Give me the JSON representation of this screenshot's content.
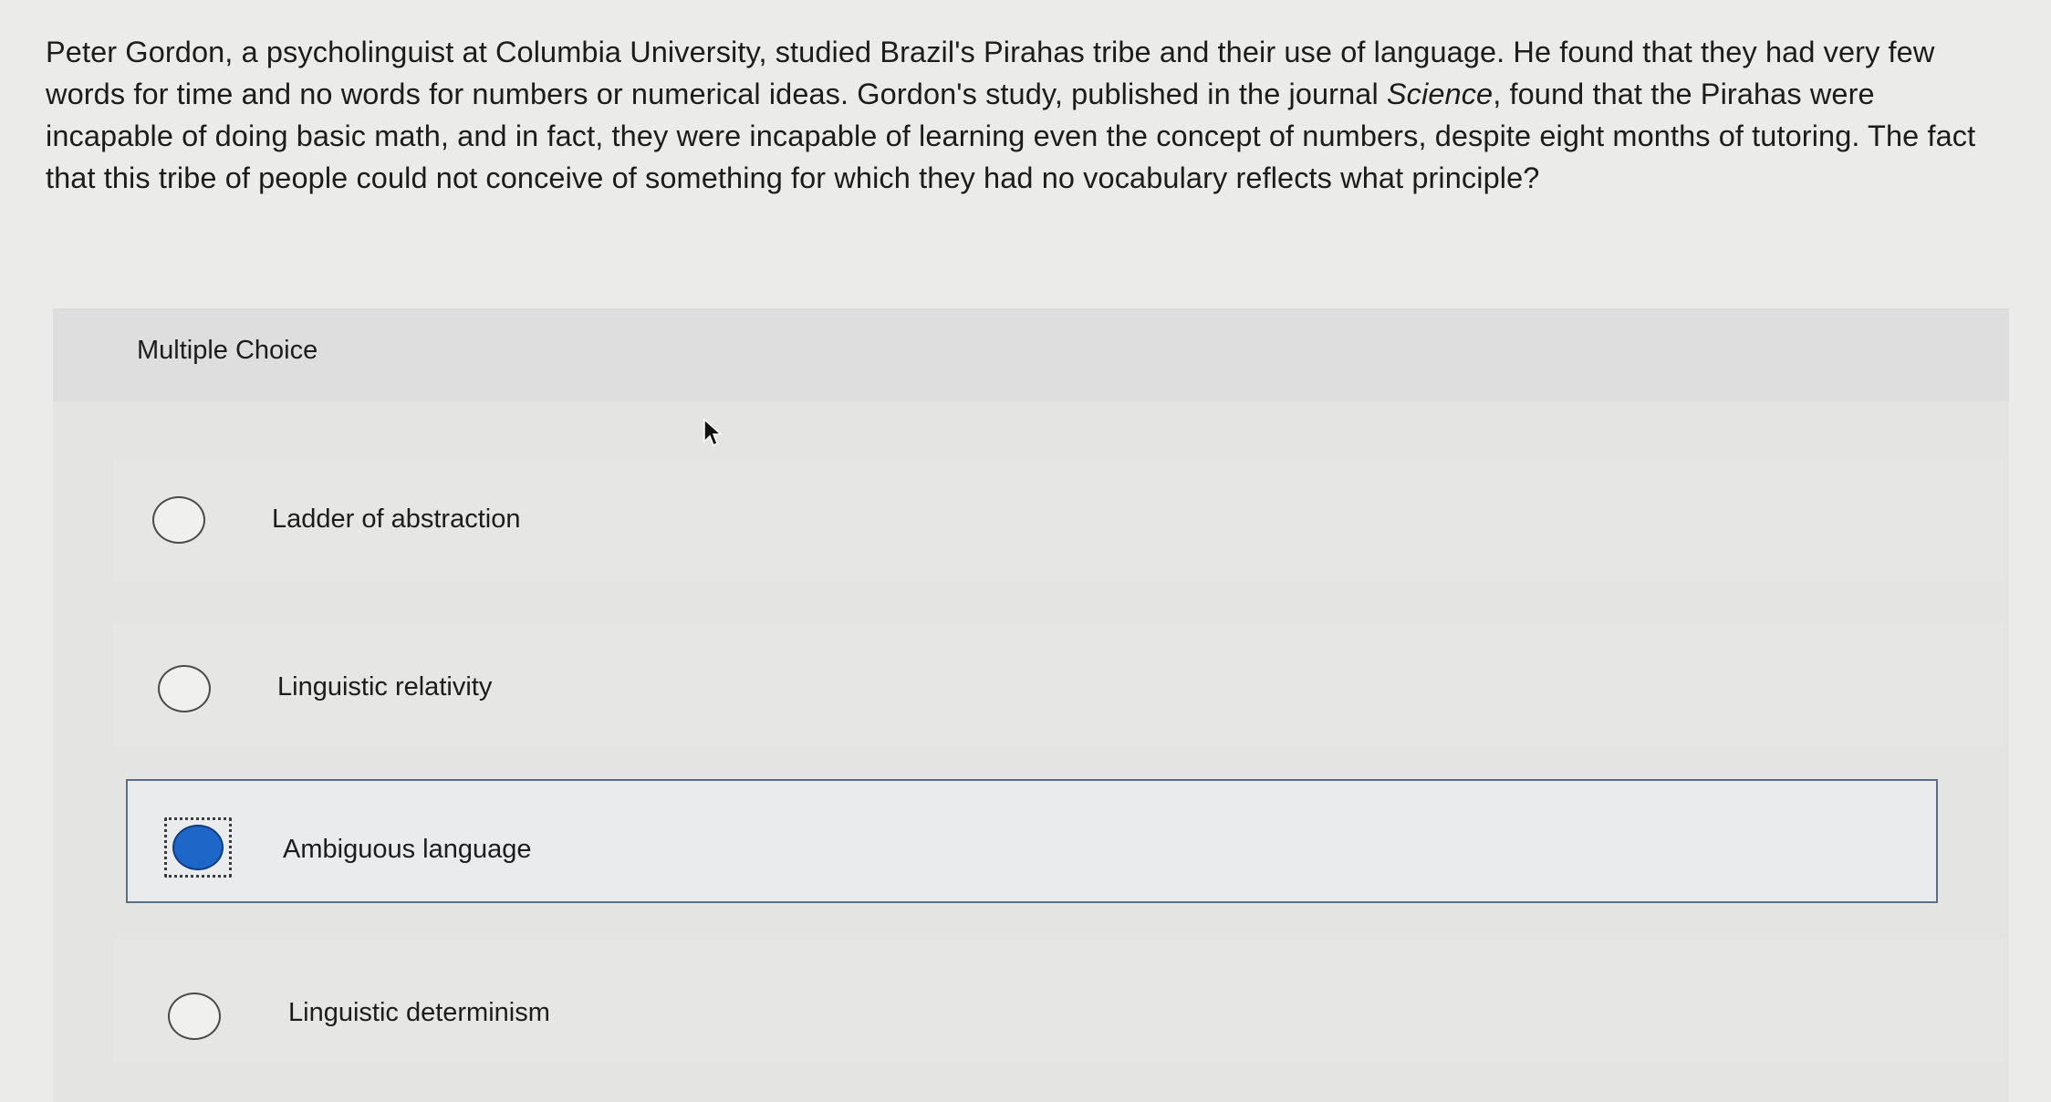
{
  "question": {
    "text_before": "Peter Gordon, a psycholinguist at Columbia University, studied Brazil's Pirahas tribe and their use of language. He found that they had very few words for time and no words for numbers or numerical ideas. Gordon's study, published in the journal ",
    "journal": "Science",
    "text_after": ", found that the Pirahas were incapable of doing basic math, and in fact, they were incapable of learning even the concept of numbers, despite eight months of tutoring. The fact that this tribe of people could not conceive of something for which they had no vocabulary reflects what principle?"
  },
  "multiple_choice": {
    "label": "Multiple Choice",
    "options": [
      {
        "label": "Ladder of abstraction",
        "selected": false
      },
      {
        "label": "Linguistic relativity",
        "selected": false
      },
      {
        "label": "Ambiguous language",
        "selected": true
      },
      {
        "label": "Linguistic determinism",
        "selected": false
      }
    ]
  },
  "colors": {
    "selected_radio": "#1f66c9",
    "selected_border": "#5a6f86",
    "background": "#ebebe9"
  },
  "icons": {
    "cursor": "mouse-pointer-icon"
  }
}
